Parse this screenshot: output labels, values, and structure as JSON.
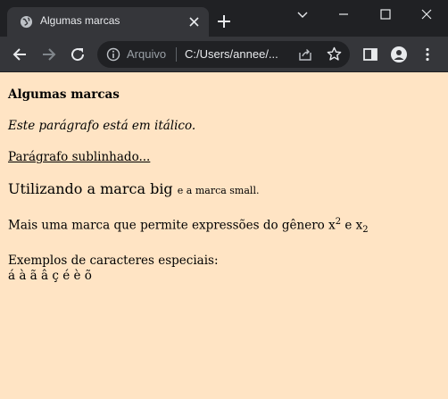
{
  "browser": {
    "tab_title": "Algumas marcas",
    "address_label": "Arquivo",
    "address_url": "C:/Users/annee/..."
  },
  "page": {
    "heading": "Algumas marcas",
    "italic_paragraph": "Este parágrafo está em itálico.",
    "underlined_paragraph": "Parágrafo sublinhado...",
    "big_text": "Utilizando a marca big",
    "small_text": "e a marca small.",
    "sup_sub_text": "Mais uma marca que permite expressões do gênero x",
    "sup_value": "2",
    "connector": "e x",
    "sub_value": "2",
    "special_heading": "Exemplos de caracteres especiais:",
    "special_chars": "á à ã â ç é è õ"
  },
  "icons": [
    "globe-icon",
    "close-icon",
    "plus-icon",
    "minimize-icon",
    "maximize-icon",
    "close-window-icon",
    "back-icon",
    "forward-icon",
    "reload-icon",
    "info-icon",
    "share-icon",
    "star-icon",
    "sidepanel-icon",
    "profile-icon",
    "menu-icon"
  ],
  "colors": {
    "page_background": "#ffe4c4",
    "titlebar": "#202124",
    "toolbar": "#35363a"
  }
}
